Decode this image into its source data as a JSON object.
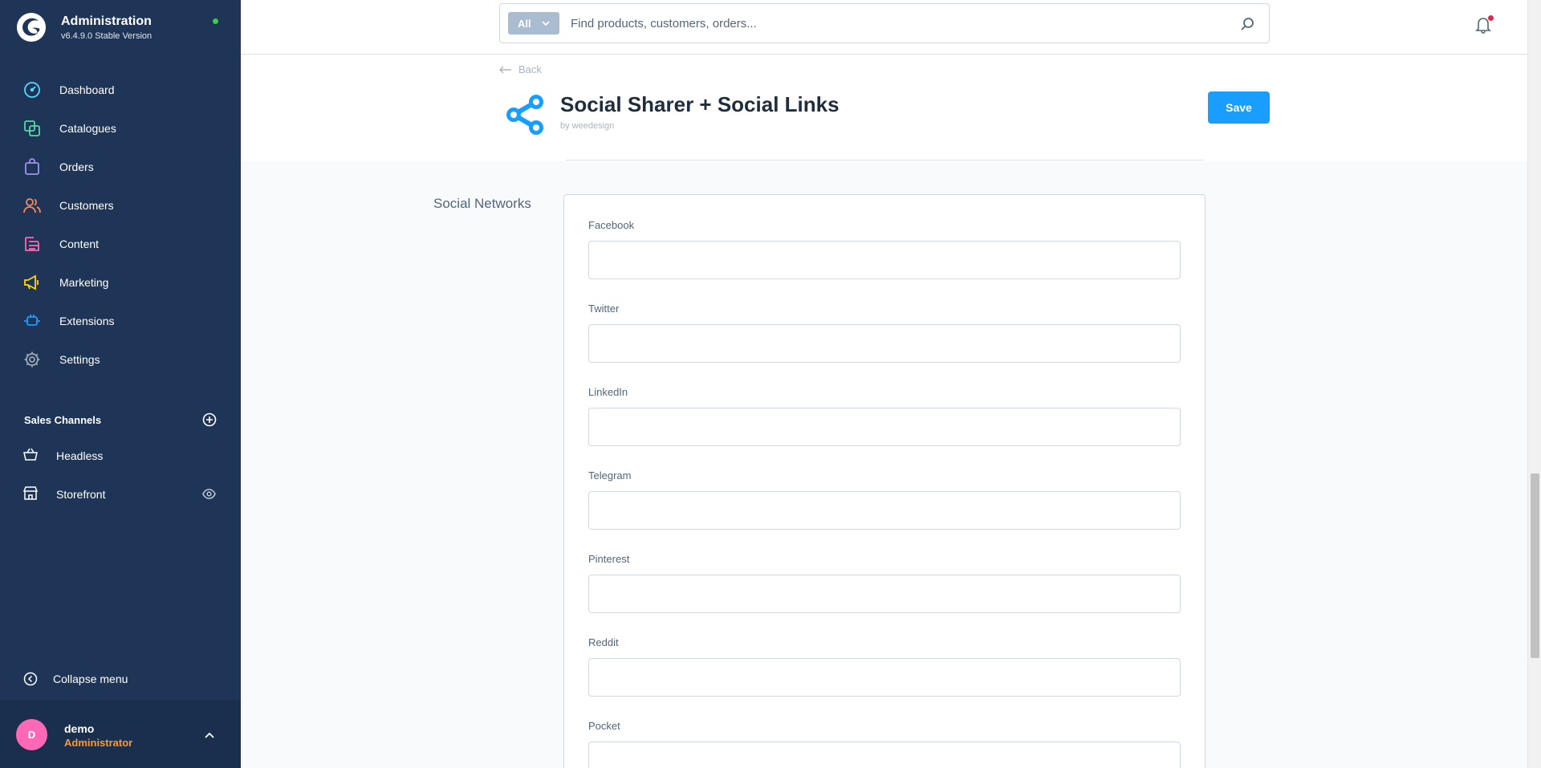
{
  "app": {
    "title": "Administration",
    "version": "v6.4.9.0 Stable Version"
  },
  "nav": {
    "items": [
      {
        "label": "Dashboard",
        "icon": "dashboard-icon",
        "color": "#57d9ff"
      },
      {
        "label": "Catalogues",
        "icon": "catalogue-icon",
        "color": "#57d9a3"
      },
      {
        "label": "Orders",
        "icon": "orders-icon",
        "color": "#a092f0"
      },
      {
        "label": "Customers",
        "icon": "customers-icon",
        "color": "#f88962"
      },
      {
        "label": "Content",
        "icon": "content-icon",
        "color": "#ff68b4"
      },
      {
        "label": "Marketing",
        "icon": "marketing-icon",
        "color": "#ffd700"
      },
      {
        "label": "Extensions",
        "icon": "extensions-icon",
        "color": "#189eff"
      },
      {
        "label": "Settings",
        "icon": "settings-icon",
        "color": "#9aa8b5"
      }
    ]
  },
  "sales_channels": {
    "title": "Sales Channels",
    "items": [
      {
        "label": "Headless"
      },
      {
        "label": "Storefront"
      }
    ]
  },
  "collapse_label": "Collapse menu",
  "user": {
    "initial": "D",
    "name": "demo",
    "role": "Administrator"
  },
  "search": {
    "type_label": "All",
    "placeholder": "Find products, customers, orders..."
  },
  "header": {
    "back_label": "Back",
    "plugin_title": "Social Sharer + Social Links",
    "plugin_author": "by weedesign",
    "save_label": "Save"
  },
  "section": {
    "label": "Social Networks",
    "fields": [
      {
        "label": "Facebook",
        "value": ""
      },
      {
        "label": "Twitter",
        "value": ""
      },
      {
        "label": "LinkedIn",
        "value": ""
      },
      {
        "label": "Telegram",
        "value": ""
      },
      {
        "label": "Pinterest",
        "value": ""
      },
      {
        "label": "Reddit",
        "value": ""
      },
      {
        "label": "Pocket",
        "value": ""
      }
    ]
  },
  "colors": {
    "sidebar_bg": "#1f3557",
    "accent": "#189eff",
    "status_online": "#37d046",
    "role_orange": "#ff9a2a"
  }
}
